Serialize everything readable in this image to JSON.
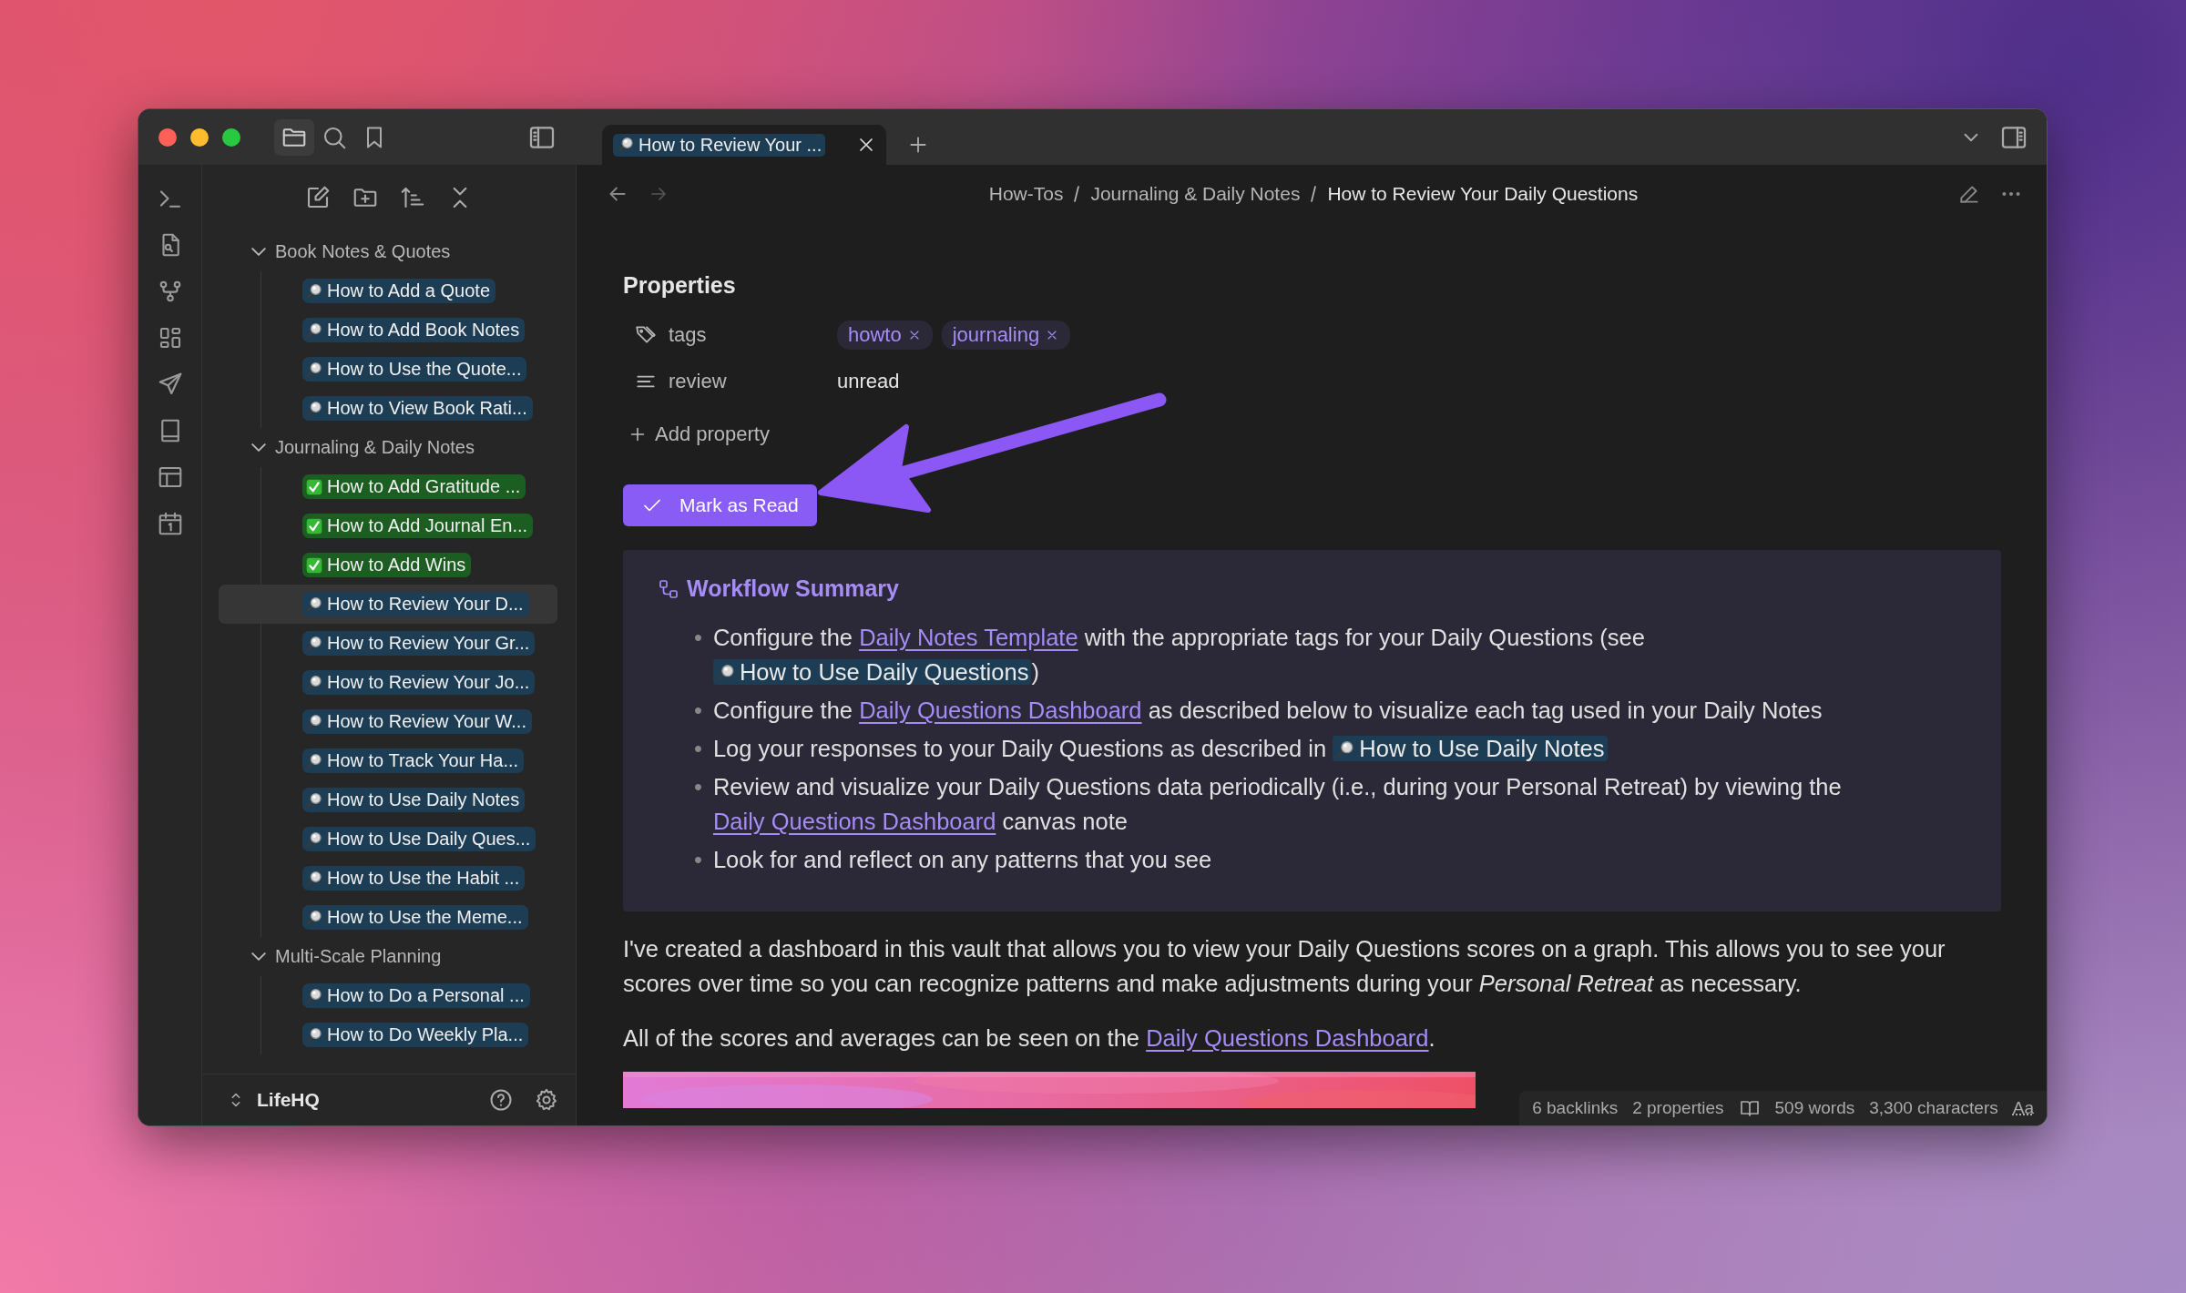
{
  "tab": {
    "kind": "search",
    "title": "How to Review Your ..."
  },
  "sidebar": {
    "folders": [
      {
        "name": "Book Notes & Quotes",
        "expanded": true,
        "children": [
          {
            "title": "How to Add a Quote",
            "kind": "search",
            "selected": false
          },
          {
            "title": "How to Add Book Notes",
            "kind": "search",
            "selected": false
          },
          {
            "title": "How to Use the Quote...",
            "kind": "search",
            "selected": false
          },
          {
            "title": "How to View Book Rati...",
            "kind": "search",
            "selected": false
          }
        ]
      },
      {
        "name": "Journaling & Daily Notes",
        "expanded": true,
        "children": [
          {
            "title": "How to Add Gratitude ...",
            "kind": "done",
            "selected": false
          },
          {
            "title": "How to Add Journal En...",
            "kind": "done",
            "selected": false
          },
          {
            "title": "How to Add Wins",
            "kind": "done",
            "selected": false
          },
          {
            "title": "How to Review Your D...",
            "kind": "search",
            "selected": true
          },
          {
            "title": "How to Review Your Gr...",
            "kind": "search",
            "selected": false
          },
          {
            "title": "How to Review Your Jo...",
            "kind": "search",
            "selected": false
          },
          {
            "title": "How to Review Your W...",
            "kind": "search",
            "selected": false
          },
          {
            "title": "How to Track Your Ha...",
            "kind": "search",
            "selected": false
          },
          {
            "title": "How to Use Daily Notes",
            "kind": "search",
            "selected": false
          },
          {
            "title": "How to Use Daily Ques...",
            "kind": "search",
            "selected": false
          },
          {
            "title": "How to Use the Habit ...",
            "kind": "search",
            "selected": false
          },
          {
            "title": "How to Use the Meme...",
            "kind": "search",
            "selected": false
          }
        ]
      },
      {
        "name": "Multi-Scale Planning",
        "expanded": true,
        "children": [
          {
            "title": "How to Do a Personal ...",
            "kind": "search",
            "selected": false
          },
          {
            "title": "How to Do Weekly Pla...",
            "kind": "search",
            "selected": false
          }
        ]
      }
    ],
    "vault": "LifeHQ"
  },
  "breadcrumb": [
    "How-Tos",
    "Journaling & Daily Notes",
    "How to Review Your Daily Questions"
  ],
  "properties": {
    "heading": "Properties",
    "items": [
      {
        "kind": "tags",
        "name": "tags",
        "tags": [
          "howto",
          "journaling"
        ]
      },
      {
        "kind": "text",
        "name": "review",
        "value": "unread"
      }
    ],
    "add": "Add property"
  },
  "button": "Mark as Read",
  "callout": {
    "title": "Workflow Summary",
    "items": [
      {
        "marker": "•",
        "parts": [
          {
            "kind": "text",
            "text": "Configure the "
          },
          {
            "kind": "link",
            "text": "Daily Notes Template"
          },
          {
            "kind": "text",
            "text": " with the appropriate tags for your Daily Questions (see "
          },
          {
            "kind": "note",
            "text": "How to Use Daily Questions"
          },
          {
            "kind": "text",
            "text": ")"
          }
        ]
      },
      {
        "marker": "•",
        "parts": [
          {
            "kind": "text",
            "text": "Configure the "
          },
          {
            "kind": "link",
            "text": "Daily Questions Dashboard"
          },
          {
            "kind": "text",
            "text": " as described below to visualize each tag used in your Daily Notes"
          }
        ]
      },
      {
        "marker": "•",
        "parts": [
          {
            "kind": "text",
            "text": "Log your responses to your Daily Questions as described in "
          },
          {
            "kind": "note",
            "text": "How to Use Daily Notes"
          }
        ]
      },
      {
        "marker": "•",
        "parts": [
          {
            "kind": "text",
            "text": "Review and visualize your Daily Questions data periodically (i.e., during your Personal Retreat) by viewing the "
          },
          {
            "kind": "link",
            "text": "Daily Questions Dashboard"
          },
          {
            "kind": "text",
            "text": " canvas note"
          }
        ]
      },
      {
        "marker": "•",
        "parts": [
          {
            "kind": "text",
            "text": "Look for and reflect on any patterns that you see"
          }
        ]
      }
    ]
  },
  "paragraphs": [
    [
      {
        "kind": "text",
        "text": "I've created a dashboard in this vault that allows you to view your Daily Questions scores on a graph. This allows you to see your scores over time so you can recognize patterns and make adjustments during your *Personal Retreat* as necessary."
      }
    ],
    [
      {
        "kind": "text",
        "text": "All of the scores and averages can be seen on the "
      },
      {
        "kind": "link",
        "text": "Daily Questions Dashboard"
      },
      {
        "kind": "text",
        "text": "."
      }
    ]
  ],
  "status_bar": {
    "backlinks": "6 backlinks",
    "properties": "2 properties",
    "words": "509 words",
    "characters": "3,300 characters",
    "font": "Aa"
  }
}
